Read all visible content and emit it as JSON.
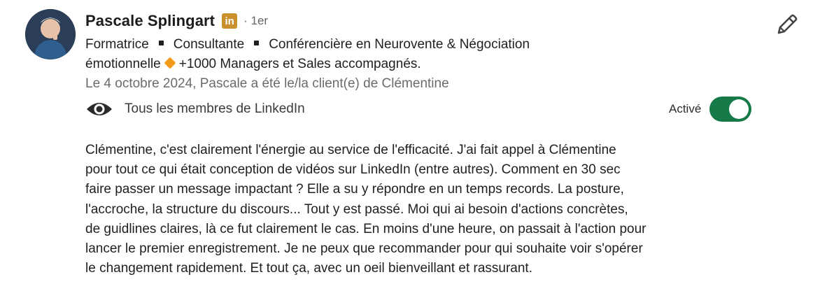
{
  "profile": {
    "name": "Pascale Splingart",
    "linkedin_badge": "in",
    "degree": "· 1er",
    "headline_parts": [
      "Formatrice",
      "Consultante",
      "Conférencière en Neurovente & Négociation"
    ],
    "headline_line2_a": "émotionnelle",
    "headline_line2_b": "+1000 Managers et Sales accompagnés.",
    "relation": "Le 4 octobre 2024, Pascale a été le/la client(e) de Clémentine"
  },
  "visibility": {
    "label": "Tous les membres de LinkedIn"
  },
  "toggle": {
    "label": "Activé",
    "state": "on"
  },
  "recommendation": {
    "text": "Clémentine, c'est clairement l'énergie au service de l'efficacité. J'ai fait appel à Clémentine\npour tout ce qui était conception de vidéos sur LinkedIn (entre autres). Comment en 30 sec\nfaire passer un message impactant ? Elle a su y répondre en un temps records. La posture,\nl'accroche, la structure du discours... Tout y est passé. Moi qui ai besoin d'actions concrètes,\nde guidlines claires, là ce fut clairement le cas. En moins d'une heure, on passait à l'action pour\nlancer le premier enregistrement. Je ne peux que recommander pour qui souhaite voir s'opérer\nle changement rapidement. Et tout ça, avec un oeil bienveillant et rassurant."
  },
  "colors": {
    "toggle_on": "#167a48",
    "linkedin_badge": "#c9902b",
    "diamond": "#f29a1a"
  },
  "icons": {
    "eye": "eye-icon",
    "edit": "pencil-icon",
    "diamond": "orange-diamond-icon"
  }
}
